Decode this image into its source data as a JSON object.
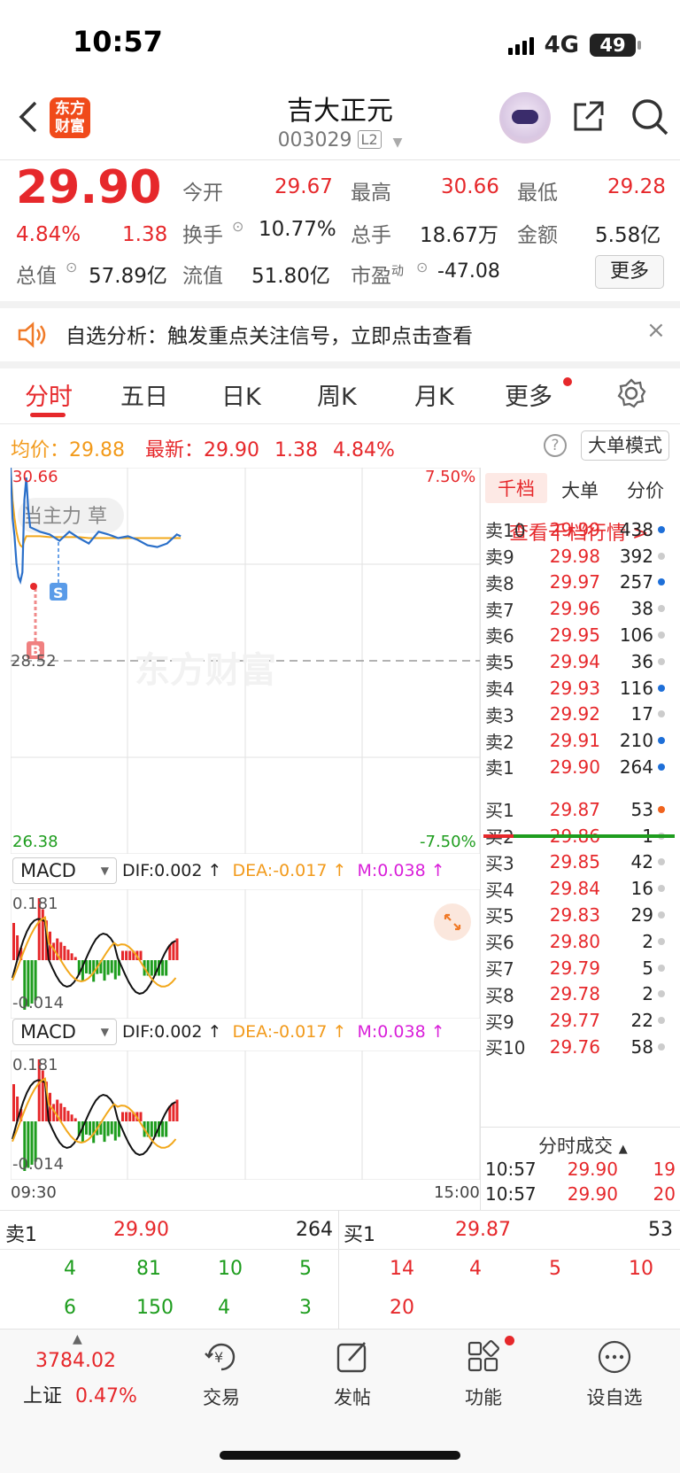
{
  "status_bar": {
    "time": "10:57",
    "network": "4G",
    "battery": "49"
  },
  "header": {
    "logo_text": "东方财富",
    "stock_name": "吉大正元",
    "stock_code": "003029",
    "level_badge": "L2"
  },
  "quote": {
    "price": "29.90",
    "change_pct": "4.84%",
    "change": "1.38",
    "open_label": "今开",
    "open": "29.67",
    "high_label": "最高",
    "high": "30.66",
    "low_label": "最低",
    "low": "29.28",
    "turnover_label": "换手",
    "turnover": "10.77%",
    "volume_label": "总手",
    "volume": "18.67万",
    "amount_label": "金额",
    "amount": "5.58亿",
    "mktcap_label": "总值",
    "mktcap": "57.89亿",
    "float_label": "流值",
    "float": "51.80亿",
    "pe_label": "市盈",
    "pe_sup": "动",
    "pe": "-47.08",
    "more_label": "更多"
  },
  "notice": {
    "text": "自选分析：触发重点关注信号，立即点击查看"
  },
  "tabs": [
    "分时",
    "五日",
    "日K",
    "周K",
    "月K",
    "更多"
  ],
  "avg_row": {
    "avg_label": "均价：",
    "avg_value": "29.88",
    "last_label": "最新：",
    "last_value": "29.90",
    "last_change": "1.38",
    "last_pct": "4.84%",
    "mode_button": "大单模式"
  },
  "chart": {
    "y_high": "30.66",
    "y_low": "26.38",
    "pct_high": "7.50%",
    "pct_low": "-7.50%",
    "prev_close": "28.52",
    "watermark": "东方财富",
    "overlay_text": "当主力 草",
    "time_start": "09:30",
    "time_end": "15:00",
    "marker_s": "S",
    "marker_b": "B"
  },
  "macd_panels": [
    {
      "selector": "MACD",
      "dif": "DIF:0.002 ↑",
      "dea": "DEA:-0.017 ↑",
      "m": "M:0.038 ↑",
      "y_top": "0.181",
      "y_bottom": "-0.014"
    },
    {
      "selector": "MACD",
      "dif": "DIF:0.002 ↑",
      "dea": "DEA:-0.017 ↑",
      "m": "M:0.038 ↑",
      "y_top": "0.181",
      "y_bottom": "-0.014"
    }
  ],
  "chart_data": {
    "type": "line",
    "title": "",
    "x": [
      "09:30",
      "09:31",
      "09:32",
      "09:33",
      "09:34",
      "09:35",
      "09:36",
      "09:37",
      "09:38",
      "09:39",
      "09:40",
      "09:45",
      "09:50",
      "09:55",
      "10:00",
      "10:05",
      "10:10",
      "10:15",
      "10:20",
      "10:25",
      "10:30",
      "10:35",
      "10:40",
      "10:45",
      "10:50",
      "10:55",
      "10:57"
    ],
    "series": [
      {
        "name": "price",
        "values": [
          30.66,
          30.1,
          29.9,
          29.6,
          29.45,
          29.4,
          29.5,
          30.3,
          30.55,
          30.2,
          30.0,
          29.95,
          29.92,
          29.85,
          29.95,
          29.88,
          29.82,
          29.95,
          29.92,
          29.88,
          29.9,
          29.86,
          29.8,
          29.78,
          29.82,
          29.92,
          29.9
        ]
      },
      {
        "name": "avg",
        "values": [
          30.66,
          30.3,
          30.1,
          29.95,
          29.85,
          29.8,
          29.78,
          29.85,
          29.9,
          29.9,
          29.9,
          29.9,
          29.89,
          29.89,
          29.89,
          29.89,
          29.88,
          29.88,
          29.88,
          29.88,
          29.88,
          29.88,
          29.88,
          29.88,
          29.88,
          29.88,
          29.88
        ]
      }
    ],
    "ylim": [
      26.38,
      30.66
    ],
    "prev_close": 28.52
  },
  "order_book": {
    "tabs": [
      "千档",
      "大单",
      "分价"
    ],
    "link": "查看千档行情 >",
    "asks": [
      {
        "label": "卖10",
        "price": "29.99",
        "vol": "438",
        "dot": "#1e6fd8"
      },
      {
        "label": "卖9",
        "price": "29.98",
        "vol": "392",
        "dot": "#cccccc"
      },
      {
        "label": "卖8",
        "price": "29.97",
        "vol": "257",
        "dot": "#1e6fd8"
      },
      {
        "label": "卖7",
        "price": "29.96",
        "vol": "38",
        "dot": "#cccccc"
      },
      {
        "label": "卖6",
        "price": "29.95",
        "vol": "106",
        "dot": "#cccccc"
      },
      {
        "label": "卖5",
        "price": "29.94",
        "vol": "36",
        "dot": "#cccccc"
      },
      {
        "label": "卖4",
        "price": "29.93",
        "vol": "116",
        "dot": "#1e6fd8"
      },
      {
        "label": "卖3",
        "price": "29.92",
        "vol": "17",
        "dot": "#cccccc"
      },
      {
        "label": "卖2",
        "price": "29.91",
        "vol": "210",
        "dot": "#1e6fd8"
      },
      {
        "label": "卖1",
        "price": "29.90",
        "vol": "264",
        "dot": "#1e6fd8"
      }
    ],
    "bids": [
      {
        "label": "买1",
        "price": "29.87",
        "vol": "53",
        "dot": "#f0631e"
      },
      {
        "label": "买2",
        "price": "29.86",
        "vol": "1",
        "dot": "#cccccc"
      },
      {
        "label": "买3",
        "price": "29.85",
        "vol": "42",
        "dot": "#cccccc"
      },
      {
        "label": "买4",
        "price": "29.84",
        "vol": "16",
        "dot": "#cccccc"
      },
      {
        "label": "买5",
        "price": "29.83",
        "vol": "29",
        "dot": "#cccccc"
      },
      {
        "label": "买6",
        "price": "29.80",
        "vol": "2",
        "dot": "#cccccc"
      },
      {
        "label": "买7",
        "price": "29.79",
        "vol": "5",
        "dot": "#cccccc"
      },
      {
        "label": "买8",
        "price": "29.78",
        "vol": "2",
        "dot": "#cccccc"
      },
      {
        "label": "买9",
        "price": "29.77",
        "vol": "22",
        "dot": "#cccccc"
      },
      {
        "label": "买10",
        "price": "29.76",
        "vol": "58",
        "dot": "#cccccc"
      }
    ],
    "tape_title": "分时成交",
    "tape": [
      {
        "time": "10:57",
        "price": "29.90",
        "vol": "19"
      },
      {
        "time": "10:57",
        "price": "29.90",
        "vol": "20"
      }
    ]
  },
  "bottom_quote": {
    "sell_label": "卖1",
    "sell_price": "29.90",
    "sell_vol": "264",
    "buy_label": "买1",
    "buy_price": "29.87",
    "buy_vol": "53",
    "sell_queue": [
      [
        "4",
        "81",
        "10",
        "5"
      ],
      [
        "6",
        "150",
        "4",
        "3"
      ]
    ],
    "buy_queue": [
      [
        "14",
        "4",
        "5",
        "10"
      ],
      [
        "20"
      ]
    ]
  },
  "tabbar": {
    "index_value": "3784.02",
    "index_name": "上证",
    "index_pct": "0.47%",
    "items": [
      "交易",
      "发帖",
      "功能",
      "设自选"
    ]
  }
}
